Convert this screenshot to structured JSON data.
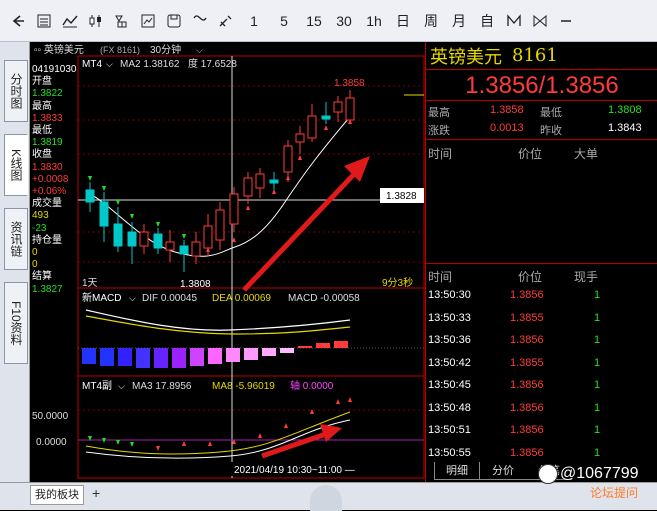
{
  "toolbar": {
    "icons": [
      "back-arrow-icon",
      "list-icon",
      "line-chart-icon",
      "candlestick-icon",
      "position-icon",
      "image-icon",
      "save-icon",
      "curve-icon",
      "draw-icon"
    ],
    "periods": [
      "1",
      "5",
      "15",
      "30",
      "1h",
      "日",
      "周",
      "月",
      "自"
    ],
    "extra": [
      "m-icon",
      "minus-icon"
    ]
  },
  "left_tabs": [
    "分时图",
    "K线图",
    "资讯链",
    "F10资料"
  ],
  "chart": {
    "title_prefix": "▫▫ 英镑美元",
    "code": "(FX 8161)",
    "period": "30分钟",
    "info": {
      "date": "04191030",
      "open_label": "开盘",
      "open": "1.3822",
      "high_label": "最高",
      "high": "1.3833",
      "low_label": "最低",
      "low": "1.3819",
      "close_label": "收盘",
      "close": "1.3830",
      "change": "+0.0008",
      "change_pct": "+0.06%",
      "volume_label": "成交量",
      "volume": "493",
      "volume_change": "-23",
      "oi_label": "持仓量",
      "oi": "0",
      "oi_change": "0",
      "settle_label": "结算",
      "settle": "1.3827"
    },
    "main_legend": {
      "ind": "MT4",
      "ma": "MA2 1.38162",
      "deg": "度 17.6528"
    },
    "high_label": "1.3858",
    "low_label": "1.3808",
    "price_box": "1.3828",
    "day_label": "1天",
    "countdown": "9分3秒",
    "macd_legend": {
      "name": "新MACD",
      "dif": "DIF 0.00045",
      "dea": "DEA 0.00069",
      "macd": "MACD -0.00058"
    },
    "sub_legend": {
      "name": "MT4副",
      "ma3": "MA3 17.8956",
      "ma8": "MA8 -5.96019",
      "axis": "轴 0.0000"
    },
    "y_label_50": "50.0000",
    "y_label_0": "0.0000",
    "time_label": "2021/04/19 10:30~11:00 —"
  },
  "quote": {
    "name": "英镑美元",
    "code": "8161",
    "price": "1.3856/1.3856",
    "rows": [
      {
        "l1": "最高",
        "v1": "1.3858",
        "l2": "最低",
        "v2": "1.3808"
      },
      {
        "l1": "涨跌",
        "v1": "0.0013",
        "l2": "昨收",
        "v2": "1.3843"
      }
    ],
    "head1": {
      "time": "时间",
      "price": "价位",
      "vol": "大单"
    },
    "head2": {
      "time": "时间",
      "price": "价位",
      "vol": "现手"
    },
    "ticks": [
      {
        "t": "13:50:30",
        "p": "1.3856",
        "v": "1"
      },
      {
        "t": "13:50:33",
        "p": "1.3855",
        "v": "1"
      },
      {
        "t": "13:50:36",
        "p": "1.3856",
        "v": "1"
      },
      {
        "t": "13:50:42",
        "p": "1.3855",
        "v": "1"
      },
      {
        "t": "13:50:45",
        "p": "1.3856",
        "v": "1"
      },
      {
        "t": "13:50:48",
        "p": "1.3856",
        "v": "1"
      },
      {
        "t": "13:50:51",
        "p": "1.3856",
        "v": "1"
      },
      {
        "t": "13:50:55",
        "p": "1.3856",
        "v": "1"
      }
    ],
    "tabs": [
      "明细",
      "分价",
      "分笔"
    ]
  },
  "bottom": {
    "tab": "我的板块",
    "add": "+"
  },
  "watermark": {
    "handle": "@1067799",
    "site": "论坛提问"
  }
}
